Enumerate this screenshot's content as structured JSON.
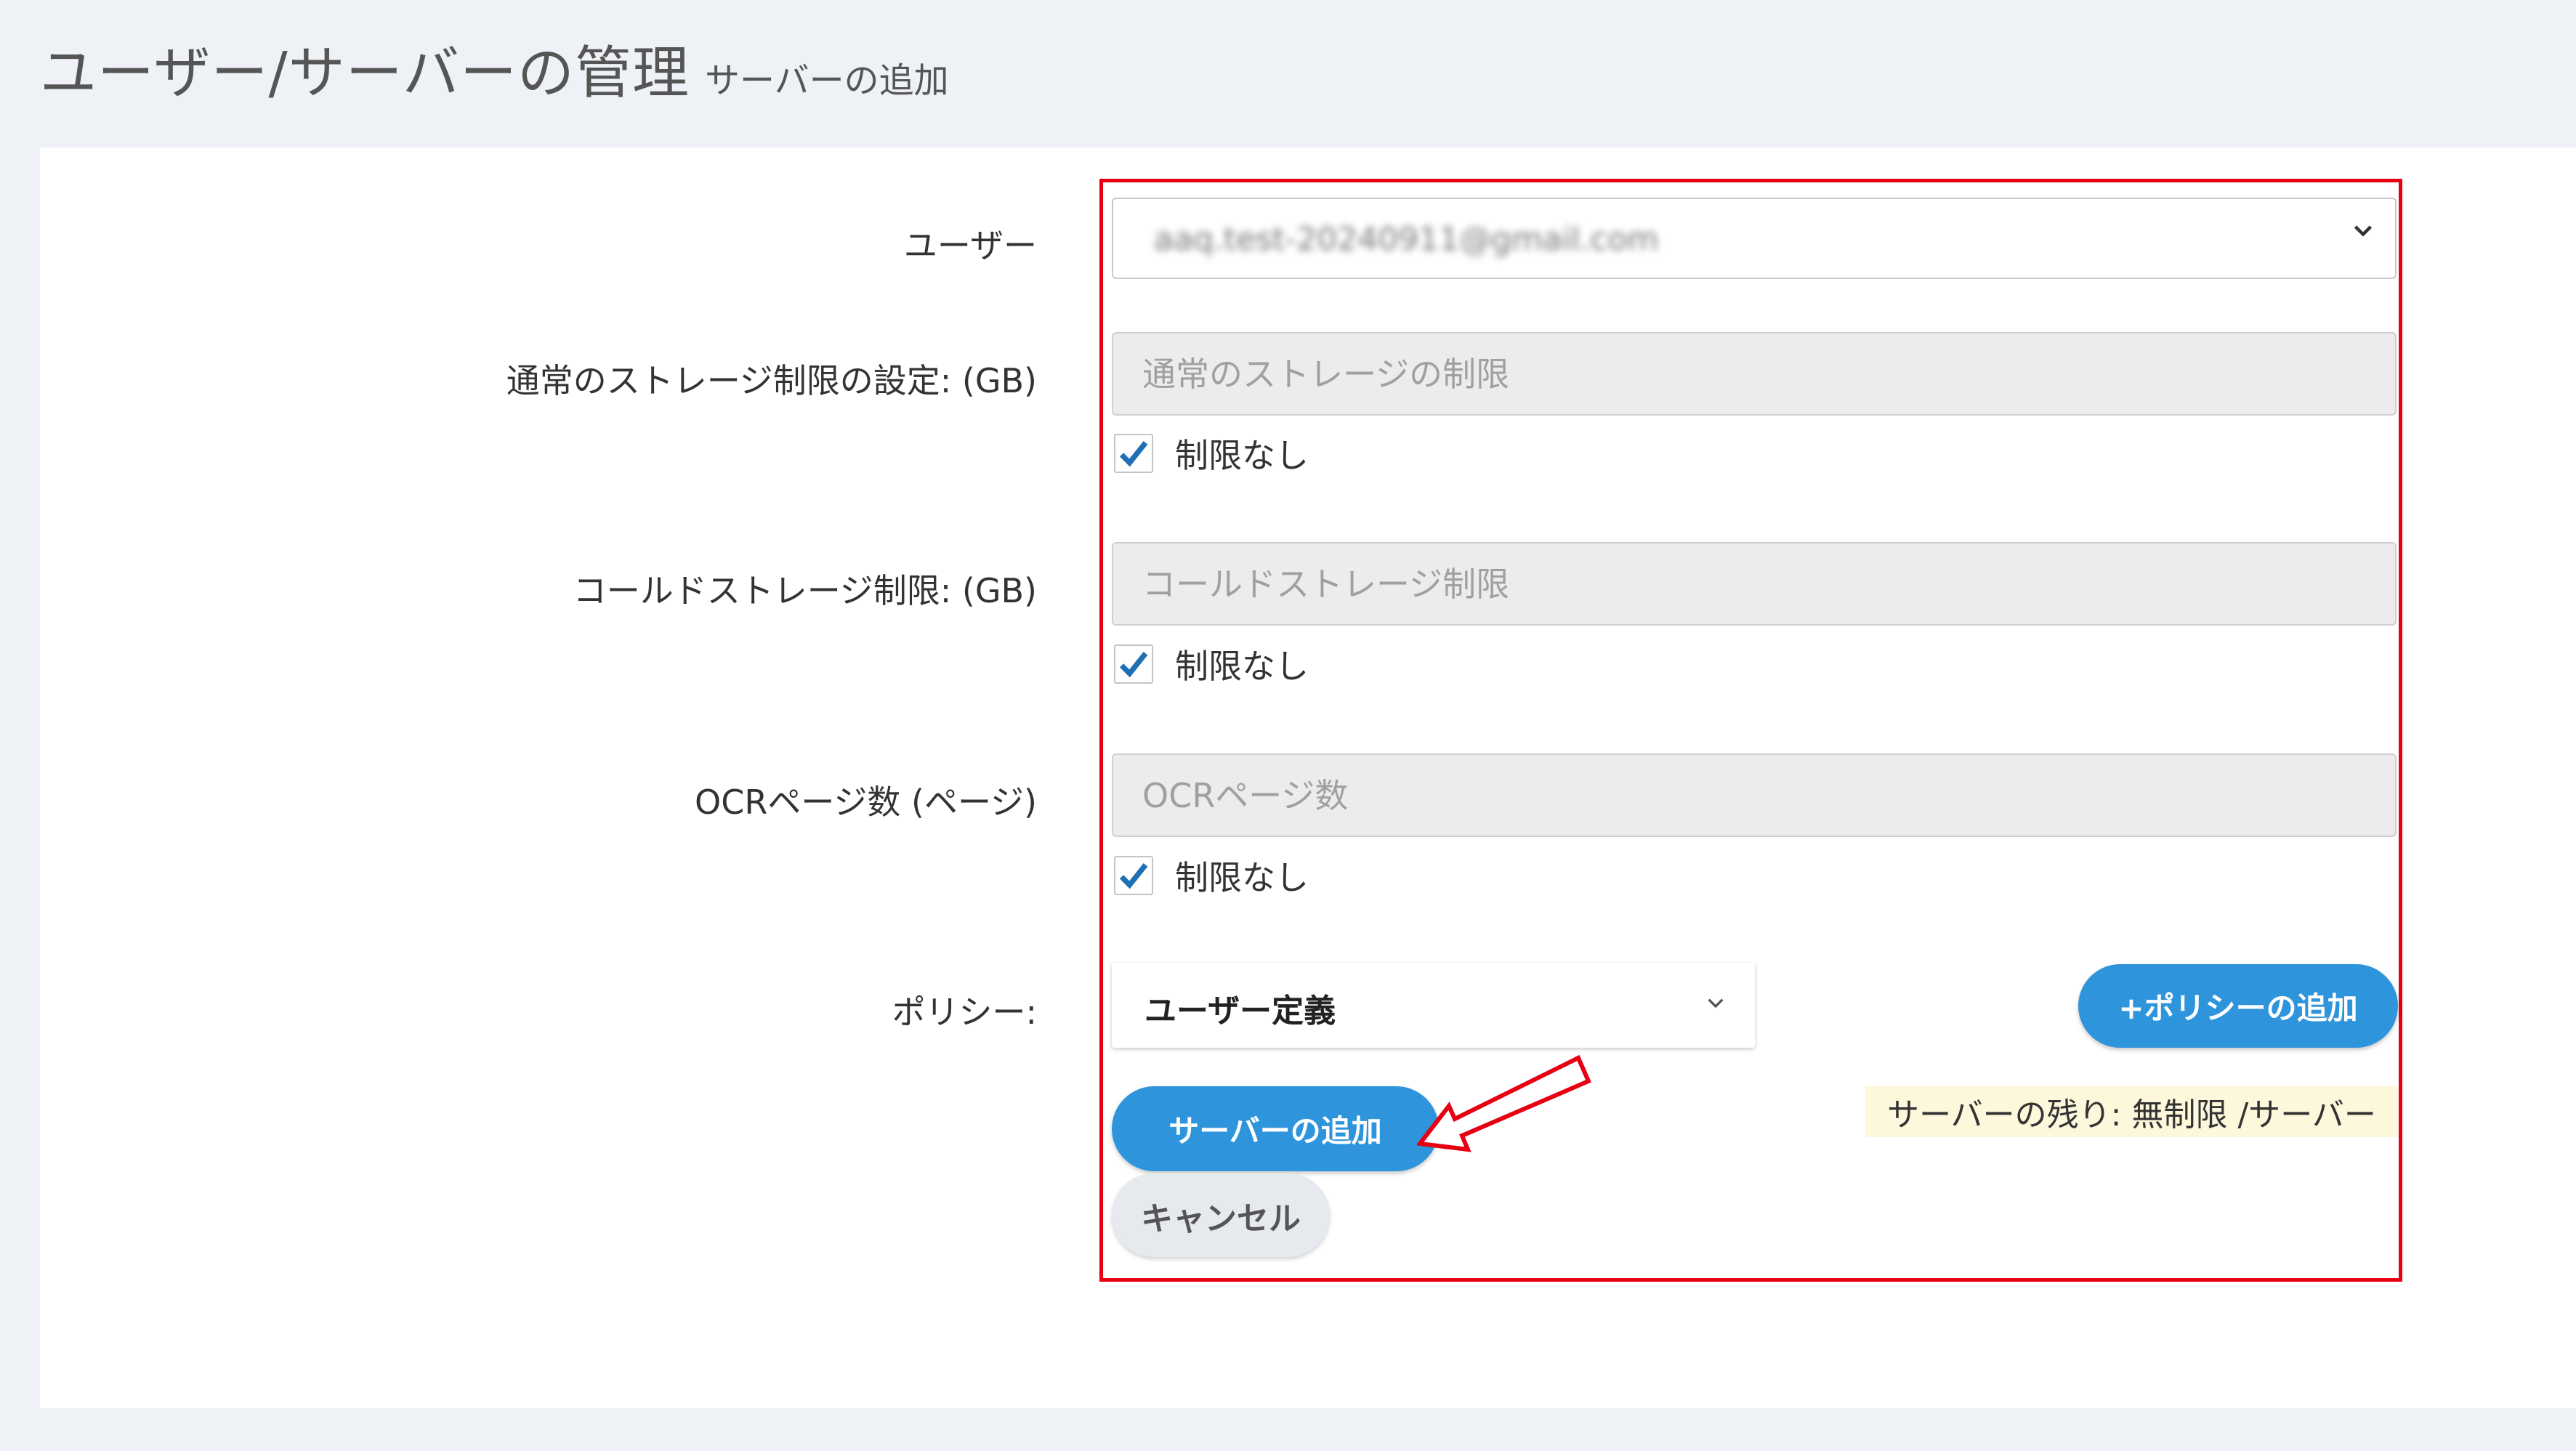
{
  "header": {
    "title": "ユーザー/サーバーの管理",
    "subtitle": "サーバーの追加"
  },
  "form": {
    "user": {
      "label": "ユーザー",
      "value": "aaq.test-20240911@gmail.com"
    },
    "normal_storage": {
      "label": "通常のストレージ制限の設定: (GB)",
      "placeholder": "通常のストレージの制限",
      "checkbox_label": "制限なし",
      "unlimited": true
    },
    "cold_storage": {
      "label": "コールドストレージ制限: (GB)",
      "placeholder": "コールドストレージ制限",
      "checkbox_label": "制限なし",
      "unlimited": true
    },
    "ocr_pages": {
      "label": "OCRページ数 (ページ)",
      "placeholder": "OCRページ数",
      "checkbox_label": "制限なし",
      "unlimited": true
    },
    "policy": {
      "label": "ポリシー:",
      "selected": "ユーザー定義",
      "add_button": "+ポリシーの追加"
    }
  },
  "actions": {
    "add_server": "サーバーの追加",
    "cancel": "キャンセル",
    "remaining": "サーバーの残り: 無制限 /サーバー"
  },
  "colors": {
    "primary": "#2e94dc",
    "highlight": "#e60012",
    "check": "#1f6fb5",
    "background": "#eef1f5"
  },
  "icons": {
    "dropdown": "chevron-down-icon",
    "check": "checkmark-icon",
    "annotation": "red-arrow-icon"
  }
}
